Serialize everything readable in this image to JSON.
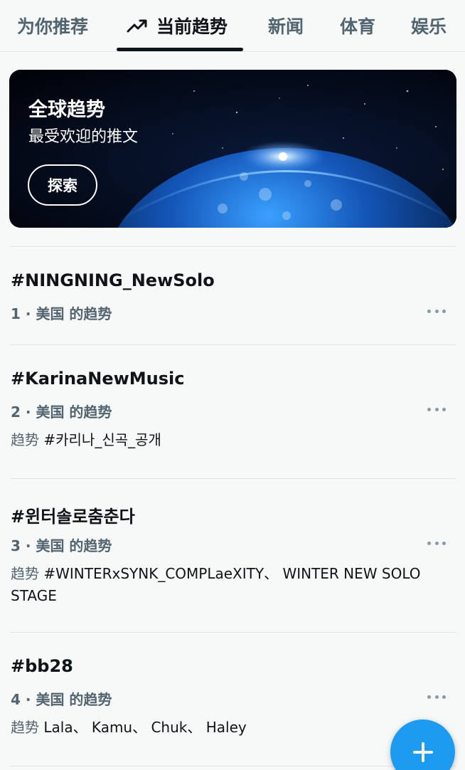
{
  "tabs": [
    {
      "label": "为你推荐"
    },
    {
      "label": "当前趋势",
      "icon": "trending-up-icon",
      "active": true
    },
    {
      "label": "新闻"
    },
    {
      "label": "体育"
    },
    {
      "label": "娱乐"
    }
  ],
  "banner": {
    "title": "全球趋势",
    "subtitle": "最受欢迎的推文",
    "button_label": "探索"
  },
  "trends": [
    {
      "title": "#NINGNING_NewSolo",
      "meta": "1 · 美国 的趋势",
      "extra_label": "",
      "extra_text": ""
    },
    {
      "title": "#KarinaNewMusic",
      "meta": "2 · 美国 的趋势",
      "extra_label": "趋势",
      "extra_text": " #카리나_신곡_공개"
    },
    {
      "title": "#윈터솔로춤춘다",
      "meta": "3 · 美国 的趋势",
      "extra_label": "趋势",
      "extra_text": " #WINTERxSYNK_COMPLaeXITY、 WINTER NEW SOLO STAGE"
    },
    {
      "title": "#bb28",
      "meta": "4 · 美国 的趋势",
      "extra_label": "趋势",
      "extra_text": " Lala、 Kamu、 Chuk、 Haley"
    }
  ],
  "fab": {
    "icon": "plus-icon"
  },
  "colors": {
    "accent": "#1d9bf0",
    "text_primary": "#0f1419",
    "text_secondary": "#536471",
    "background": "#f7f9f9"
  }
}
